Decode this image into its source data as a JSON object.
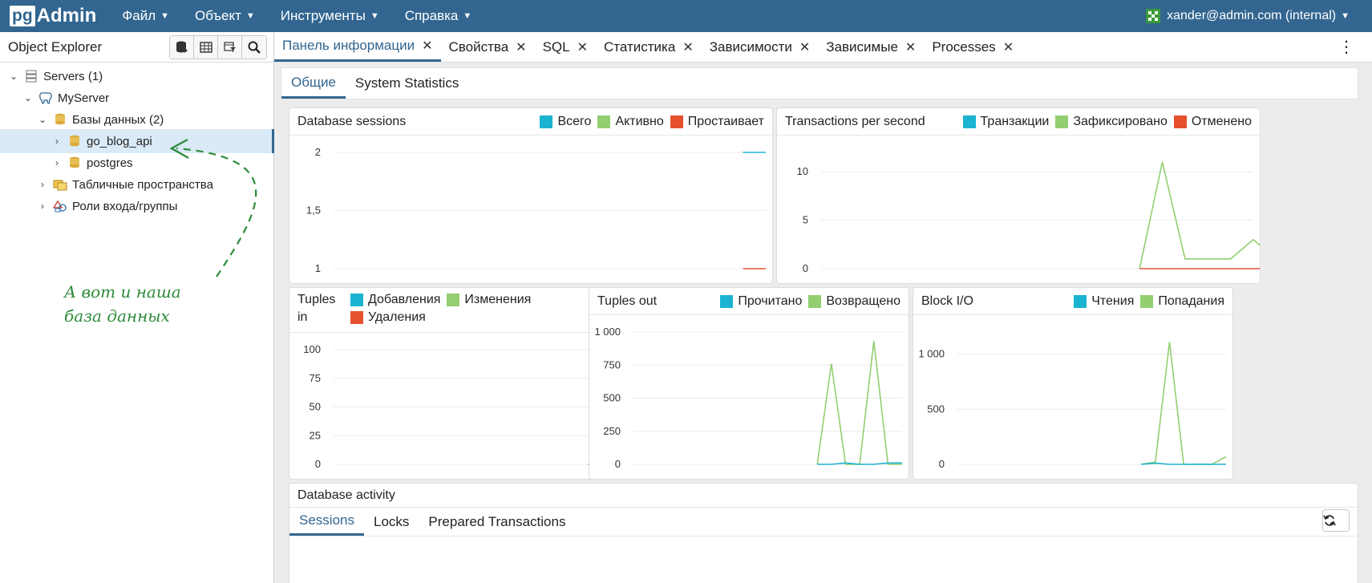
{
  "app": {
    "logo_pg": "pg",
    "logo_admin": "Admin"
  },
  "menu": [
    "Файл",
    "Объект",
    "Инструменты",
    "Справка"
  ],
  "user": {
    "label": "xander@admin.com (internal)"
  },
  "explorer": {
    "title": "Object Explorer",
    "tree": [
      {
        "label": "Servers (1)",
        "icon": "server-group-icon",
        "level": 0,
        "expanded": true
      },
      {
        "label": "MyServer",
        "icon": "postgres-elephant-icon",
        "level": 1,
        "expanded": true
      },
      {
        "label": "Базы данных (2)",
        "icon": "databases-icon",
        "level": 2,
        "expanded": true
      },
      {
        "label": "go_blog_api",
        "icon": "database-icon",
        "level": 3,
        "expanded": false,
        "selected": true
      },
      {
        "label": "postgres",
        "icon": "database-icon",
        "level": 3,
        "expanded": false
      },
      {
        "label": "Табличные пространства",
        "icon": "tablespace-icon",
        "level": 2,
        "expanded": false
      },
      {
        "label": "Роли входа/группы",
        "icon": "roles-icon",
        "level": 2,
        "expanded": false
      }
    ]
  },
  "annotation": {
    "line1": "А вот и наша",
    "line2": "база данных"
  },
  "tabs": [
    {
      "label": "Панель информации",
      "active": true
    },
    {
      "label": "Свойства"
    },
    {
      "label": "SQL"
    },
    {
      "label": "Статистика"
    },
    {
      "label": "Зависимости"
    },
    {
      "label": "Зависимые"
    },
    {
      "label": "Processes"
    }
  ],
  "subtabs": [
    {
      "label": "Общие",
      "active": true
    },
    {
      "label": "System Statistics"
    }
  ],
  "colors": {
    "cyan": "#1bb3d0",
    "green": "#93ce70",
    "red": "#e5512f",
    "brand": "#326690"
  },
  "chart_data": [
    {
      "id": "db_sessions",
      "type": "line",
      "title": "Database sessions",
      "legend": [
        {
          "name": "Всего",
          "color": "#1bb3d0"
        },
        {
          "name": "Активно",
          "color": "#93ce70"
        },
        {
          "name": "Простаивает",
          "color": "#e5512f"
        }
      ],
      "yticks": [
        {
          "v": 1,
          "label": "1"
        },
        {
          "v": 1.5,
          "label": "1,5"
        },
        {
          "v": 2,
          "label": "2"
        }
      ],
      "ylim": [
        1,
        2
      ],
      "npoints": 20,
      "series": [
        {
          "color": "#1bb3d0",
          "start": 18,
          "values": [
            2,
            2
          ]
        },
        {
          "color": "#e5512f",
          "start": 18,
          "values": [
            1,
            1
          ]
        }
      ]
    },
    {
      "id": "tps",
      "type": "line",
      "title": "Transactions per second",
      "legend": [
        {
          "name": "Транзакции",
          "color": "#1bb3d0"
        },
        {
          "name": "Зафиксировано",
          "color": "#93ce70"
        },
        {
          "name": "Отменено",
          "color": "#e5512f"
        }
      ],
      "yticks": [
        {
          "v": 0,
          "label": "0"
        },
        {
          "v": 5,
          "label": "5"
        },
        {
          "v": 10,
          "label": "10"
        }
      ],
      "ylim": [
        0,
        12
      ],
      "npoints": 20,
      "series": [
        {
          "color": "#93ce70",
          "start": 14,
          "values": [
            0,
            11,
            1,
            1,
            1,
            3,
            1
          ]
        },
        {
          "color": "#e5512f",
          "start": 14,
          "values": [
            0,
            0,
            0,
            0,
            0,
            0,
            0
          ]
        }
      ]
    },
    {
      "id": "tuples_in",
      "type": "line",
      "title_lines": [
        "Tuples",
        "in"
      ],
      "legend": [
        {
          "name": "Добавления",
          "color": "#1bb3d0"
        },
        {
          "name": "Изменения",
          "color": "#93ce70"
        },
        {
          "name": "Удаления",
          "color": "#e5512f"
        }
      ],
      "yticks": [
        {
          "v": 0,
          "label": "0"
        },
        {
          "v": 25,
          "label": "25"
        },
        {
          "v": 50,
          "label": "50"
        },
        {
          "v": 75,
          "label": "75"
        },
        {
          "v": 100,
          "label": "100"
        }
      ],
      "ylim": [
        0,
        100
      ],
      "npoints": 20,
      "series": [
        {
          "color": "#93ce70",
          "start": 18,
          "values": [
            0,
            0
          ]
        },
        {
          "color": "#e5512f",
          "start": 18,
          "values": [
            0,
            0
          ]
        }
      ]
    },
    {
      "id": "tuples_out",
      "type": "line",
      "title": "Tuples out",
      "legend": [
        {
          "name": "Прочитано",
          "color": "#1bb3d0"
        },
        {
          "name": "Возвращено",
          "color": "#93ce70"
        }
      ],
      "yticks": [
        {
          "v": 0,
          "label": "0"
        },
        {
          "v": 250,
          "label": "250"
        },
        {
          "v": 500,
          "label": "500"
        },
        {
          "v": 750,
          "label": "750"
        },
        {
          "v": 1000,
          "label": "1 000"
        }
      ],
      "ylim": [
        0,
        1000
      ],
      "npoints": 20,
      "series": [
        {
          "color": "#93ce70",
          "start": 13,
          "values": [
            0,
            760,
            0,
            0,
            930,
            0,
            0
          ]
        },
        {
          "color": "#1bb3d0",
          "start": 13,
          "values": [
            0,
            0,
            10,
            0,
            0,
            10,
            10
          ]
        }
      ]
    },
    {
      "id": "block_io",
      "type": "line",
      "title": "Block I/O",
      "legend": [
        {
          "name": "Чтения",
          "color": "#1bb3d0"
        },
        {
          "name": "Попадания",
          "color": "#93ce70"
        }
      ],
      "yticks": [
        {
          "v": 0,
          "label": "0"
        },
        {
          "v": 500,
          "label": "500"
        },
        {
          "v": 1000,
          "label": "1 000"
        }
      ],
      "ylim": [
        0,
        1200
      ],
      "npoints": 20,
      "series": [
        {
          "color": "#93ce70",
          "start": 13,
          "values": [
            0,
            20,
            1110,
            0,
            0,
            0,
            70
          ]
        },
        {
          "color": "#1bb3d0",
          "start": 13,
          "values": [
            0,
            10,
            0,
            0,
            0,
            0,
            0
          ]
        }
      ]
    }
  ],
  "activity": {
    "title": "Database activity",
    "tabs": [
      {
        "label": "Sessions",
        "active": true
      },
      {
        "label": "Locks"
      },
      {
        "label": "Prepared Transactions"
      }
    ]
  }
}
